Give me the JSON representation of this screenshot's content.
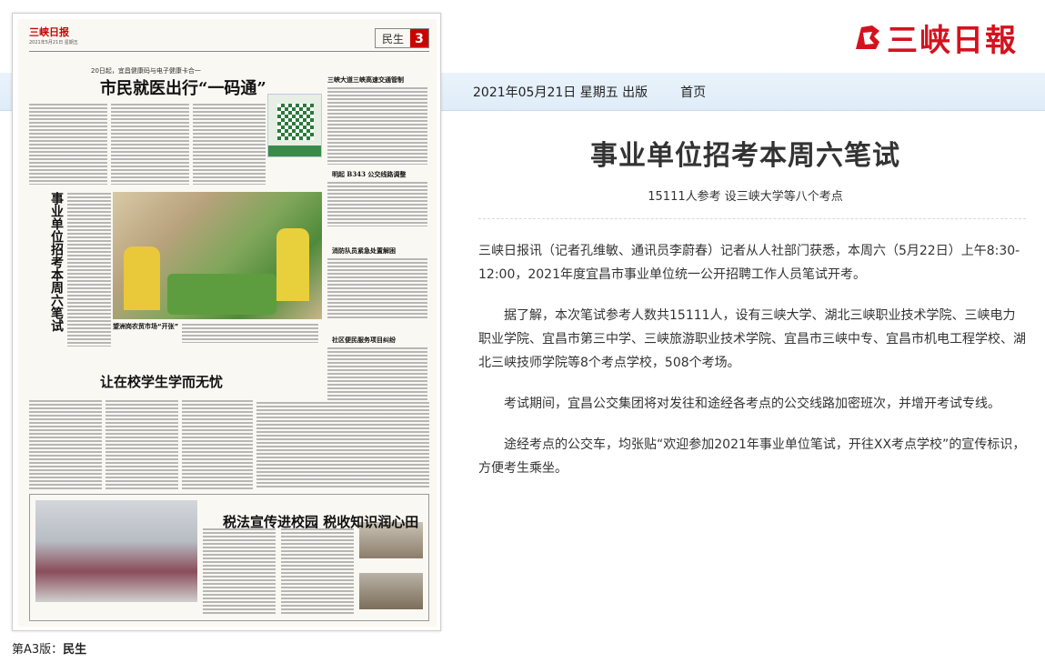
{
  "brand": {
    "logo_text": "三峡日報",
    "accent": "#d4121e"
  },
  "infobar": {
    "date_text": "2021年05月21日 星期五 出版",
    "home_link": "首页"
  },
  "newspaper": {
    "masthead_logo": "三峡日报",
    "masthead_date": "2021年5月21日 星期五",
    "section_name": "民生",
    "section_number": "3",
    "headline_kicker": "20日起，宜昌健康码与电子健康卡合一",
    "headline_main": "市民就医出行“一码通”",
    "vertical_headline": "事业单位招考本周六笔试",
    "right_head1": "三峡大道三峡高速交通管制",
    "right_head2": "明起 B343 公交线路调整",
    "right_head3": "消防队员紧急处置解困",
    "right_head4": "社区便民服务项目纠纷",
    "photo_caption": "望洲岗农贸市场“开张”",
    "headline_third": "让在校学生学而无忧",
    "headline_fourth": "税法宣传进校园 税收知识润心田"
  },
  "page_caption": {
    "prefix": "第A3版：",
    "section": "民生"
  },
  "article": {
    "title": "事业单位招考本周六笔试",
    "subtitle": "15111人参考 设三峡大学等八个考点",
    "paragraphs": [
      "三峡日报讯（记者孔维敏、通讯员李蔚春）记者从人社部门获悉，本周六（5月22日）上午8:30-12:00，2021年度宜昌市事业单位统一公开招聘工作人员笔试开考。",
      "据了解，本次笔试参考人数共15111人，设有三峡大学、湖北三峡职业技术学院、三峡电力职业学院、宜昌市第三中学、三峡旅游职业技术学院、宜昌市三峡中专、宜昌市机电工程学校、湖北三峡技师学院等8个考点学校，508个考场。",
      "考试期间，宜昌公交集团将对发往和途经各考点的公交线路加密班次，并增开考试专线。",
      "途经考点的公交车，均张贴“欢迎参加2021年事业单位笔试，开往XX考点学校”的宣传标识，方便考生乘坐。"
    ]
  }
}
